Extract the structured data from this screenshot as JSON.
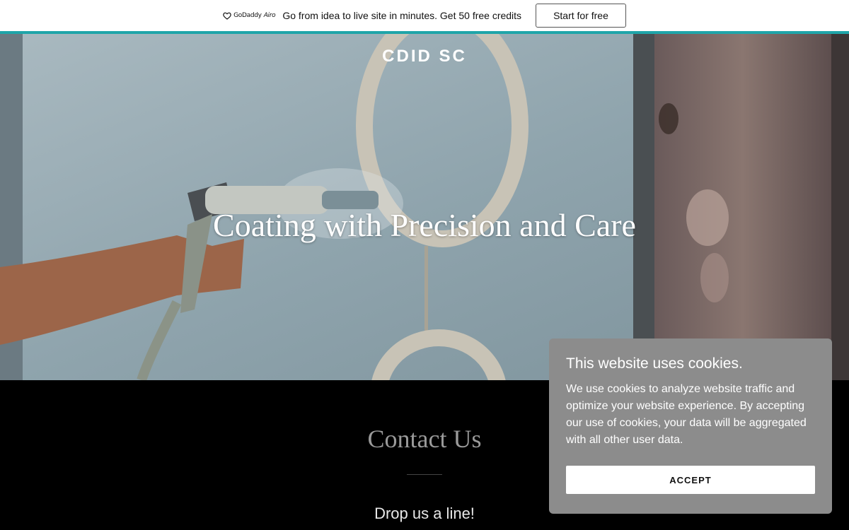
{
  "promo": {
    "brand": "GoDaddy",
    "brand_suffix": "Airo",
    "message": "Go from idea to live site in minutes. Get 50 free credits",
    "cta": "Start for free"
  },
  "hero": {
    "site_title": "CDID SC",
    "headline": "Coating with Precision and Care"
  },
  "contact": {
    "heading": "Contact Us",
    "subheading": "Drop us a line!"
  },
  "cookie": {
    "title": "This website uses cookies.",
    "text": "We use cookies to analyze website traffic and optimize your website experience. By accepting our use of cookies, your data will be aggregated with all other user data.",
    "accept": "ACCEPT"
  },
  "colors": {
    "accent_bar": "#1fa5a9",
    "cookie_bg": "#8c8c8c",
    "contact_bg": "#000000"
  }
}
